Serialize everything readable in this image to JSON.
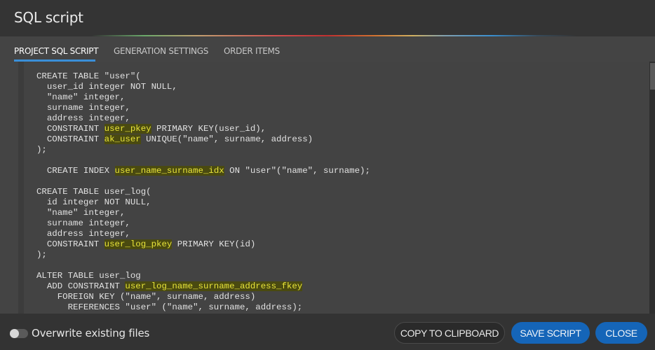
{
  "dialog": {
    "title": "SQL script"
  },
  "tabs": [
    {
      "label": "PROJECT SQL SCRIPT",
      "active": true
    },
    {
      "label": "GENERATION SETTINGS",
      "active": false
    },
    {
      "label": "ORDER ITEMS",
      "active": false
    }
  ],
  "colors": {
    "accent": "#3a8fd8",
    "primary_button": "#1565b8",
    "highlight_bg": "#4a4a10",
    "highlight_text": "#e8e43a"
  },
  "code": {
    "lines": [
      [
        {
          "t": "CREATE TABLE \"user\"("
        }
      ],
      [
        {
          "t": "  user_id integer NOT NULL,"
        }
      ],
      [
        {
          "t": "  \"name\" integer,"
        }
      ],
      [
        {
          "t": "  surname integer,"
        }
      ],
      [
        {
          "t": "  address integer,"
        }
      ],
      [
        {
          "t": "  CONSTRAINT "
        },
        {
          "t": "user_pkey",
          "h": true
        },
        {
          "t": " PRIMARY KEY(user_id),"
        }
      ],
      [
        {
          "t": "  CONSTRAINT "
        },
        {
          "t": "ak_user",
          "h": true
        },
        {
          "t": " UNIQUE(\"name\", surname, address)"
        }
      ],
      [
        {
          "t": ");"
        }
      ],
      [
        {
          "t": ""
        }
      ],
      [
        {
          "t": "  CREATE INDEX "
        },
        {
          "t": "user_name_surname_idx",
          "h": true
        },
        {
          "t": " ON \"user\"(\"name\", surname);"
        }
      ],
      [
        {
          "t": ""
        }
      ],
      [
        {
          "t": "CREATE TABLE user_log("
        }
      ],
      [
        {
          "t": "  id integer NOT NULL,"
        }
      ],
      [
        {
          "t": "  \"name\" integer,"
        }
      ],
      [
        {
          "t": "  surname integer,"
        }
      ],
      [
        {
          "t": "  address integer,"
        }
      ],
      [
        {
          "t": "  CONSTRAINT "
        },
        {
          "t": "user_log_pkey",
          "h": true
        },
        {
          "t": " PRIMARY KEY(id)"
        }
      ],
      [
        {
          "t": ");"
        }
      ],
      [
        {
          "t": ""
        }
      ],
      [
        {
          "t": "ALTER TABLE user_log"
        }
      ],
      [
        {
          "t": "  ADD CONSTRAINT "
        },
        {
          "t": "user_log_name_surname_address_fkey",
          "h": true
        }
      ],
      [
        {
          "t": "    FOREIGN KEY (\"name\", surname, address)"
        }
      ],
      [
        {
          "t": "      REFERENCES \"user\" (\"name\", surname, address);"
        }
      ]
    ]
  },
  "footer": {
    "overwrite_label": "Overwrite existing files",
    "overwrite_on": false,
    "copy_label": "COPY TO CLIPBOARD",
    "save_label": "SAVE SCRIPT",
    "close_label": "CLOSE"
  }
}
